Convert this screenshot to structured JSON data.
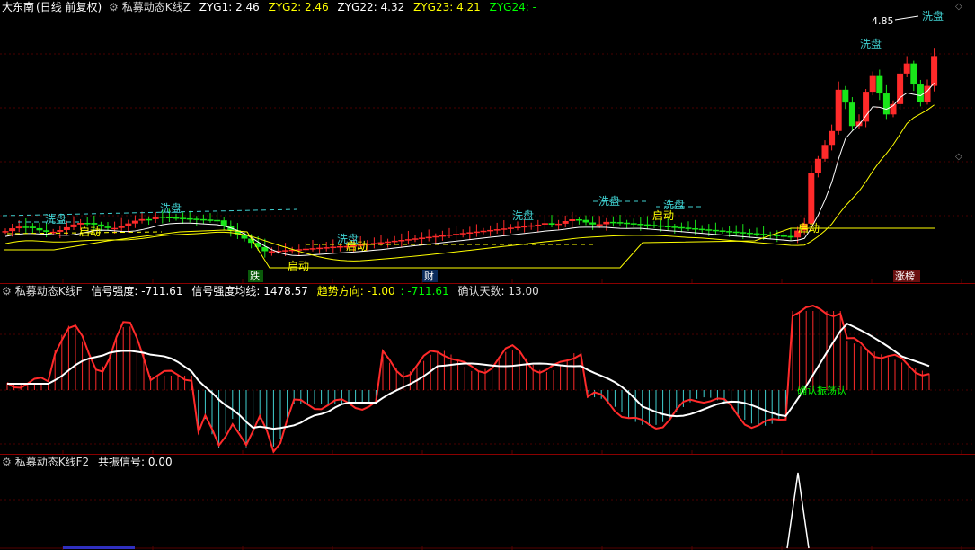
{
  "colors": {
    "up": "#ff2a2a",
    "down": "#19e619",
    "yellow": "#ffff00",
    "white": "#ffffff",
    "cyan": "#40d0d0",
    "grid": "#8b0000",
    "label": "#ffcc00",
    "green": "#00ff00"
  },
  "main_panel": {
    "stock_name": "大东南",
    "period": "(日线 前复权)",
    "indicator": "私募动态K线Z",
    "zyg1": {
      "label": "ZYG1:",
      "value": "2.46"
    },
    "zyg2": {
      "label": "ZYG2:",
      "value": "2.46"
    },
    "zyg22": {
      "label": "ZYG22:",
      "value": "4.32"
    },
    "zyg23": {
      "label": "ZYG23:",
      "value": "4.21"
    },
    "zyg24": {
      "label": "ZYG24:",
      "value": "-"
    },
    "high_price": "4.85",
    "tags": {
      "wash": "洗盘",
      "start": "启动",
      "fall": "跌",
      "cai": "财",
      "limit": "涨榜"
    }
  },
  "sub_panel_f": {
    "indicator": "私募动态K线F",
    "strength": {
      "label": "信号强度:",
      "value": "-711.61"
    },
    "strength_ma": {
      "label": "信号强度均线:",
      "value": "1478.57"
    },
    "trend": {
      "label": "趋势方向:",
      "value": "-1.00"
    },
    "trend2": {
      "label": ":",
      "value": "-711.61"
    },
    "confirm_days": {
      "label": "确认天数:",
      "value": "13.00"
    },
    "overlay_text": "确认振荡认"
  },
  "sub_panel_f2": {
    "indicator": "私募动态K线F2",
    "resonance": {
      "label": "共振信号:",
      "value": "0.00"
    }
  },
  "chart_data": [
    {
      "type": "candlestick",
      "title": "私募动态K线Z",
      "series": [
        {
          "name": "ZYG1",
          "last": 2.46
        },
        {
          "name": "ZYG2",
          "last": 2.46
        },
        {
          "name": "ZYG22",
          "last": 4.32
        },
        {
          "name": "ZYG23",
          "last": 4.21
        }
      ],
      "annotations": [
        "4.85",
        "洗盘",
        "启动",
        "跌",
        "财",
        "涨榜"
      ]
    },
    {
      "type": "line",
      "title": "私募动态K线F",
      "series": [
        {
          "name": "信号强度",
          "last": -711.61
        },
        {
          "name": "信号强度均线",
          "last": 1478.57
        }
      ]
    },
    {
      "type": "line",
      "title": "私募动态K线F2",
      "series": [
        {
          "name": "共振信号",
          "last": 0.0
        }
      ]
    }
  ]
}
